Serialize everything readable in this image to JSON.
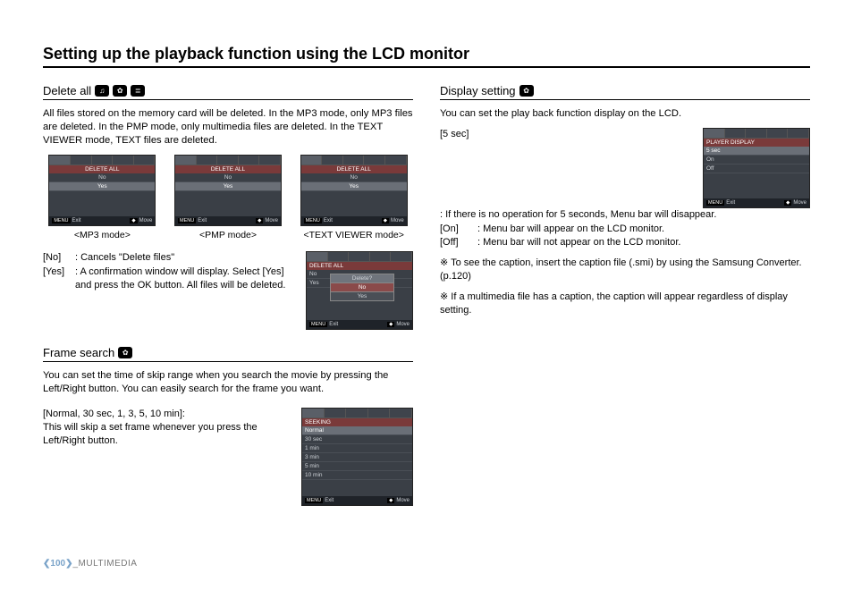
{
  "title": "Setting up the playback function using the LCD monitor",
  "footer": {
    "page": "100",
    "section": "_MULTIMEDIA"
  },
  "icons": {
    "music": "♫",
    "gear": "✿",
    "text": "≣"
  },
  "screen_ui": {
    "menu_label": "MENU",
    "exit": "Exit",
    "move": "Move",
    "arrows": "◆"
  },
  "left": {
    "delete_all": {
      "title": "Delete all",
      "body": "All files stored on the memory card will be deleted. In the MP3 mode, only MP3 files are deleted. In the PMP mode, only multimedia files are deleted. In the TEXT VIEWER mode, TEXT files are deleted.",
      "screens": {
        "header": "DELETE ALL",
        "items": [
          "No",
          "Yes"
        ],
        "captions": [
          "<MP3 mode>",
          "<PMP mode>",
          "<TEXT VIEWER mode>"
        ]
      },
      "options": [
        {
          "label": "[No]",
          "desc": ": Cancels \"Delete files\""
        },
        {
          "label": "[Yes]",
          "desc": ": A confirmation window will display. Select [Yes] and press the OK button. All files will be deleted."
        }
      ],
      "dialog": {
        "title": "Delete?",
        "opts": [
          "No",
          "Yes"
        ]
      }
    },
    "frame_search": {
      "title": "Frame search",
      "body": "You can set the time of skip range when you search the movie by pressing the Left/Right button. You can easily search for the frame you want.",
      "option_title": "[Normal, 30 sec, 1, 3, 5, 10 min]:",
      "option_body": "This will skip a set frame whenever you press the Left/Right button.",
      "screen": {
        "header": "SEEKING",
        "items": [
          "Normal",
          "30 sec",
          "1 min",
          "3 min",
          "5 min",
          "10 min"
        ]
      }
    }
  },
  "right": {
    "display_setting": {
      "title": "Display setting",
      "body": "You can set the play back function display on the LCD.",
      "options": [
        {
          "label": "[5 sec]",
          "desc": ": If there is no operation for 5 seconds, Menu bar will disappear."
        },
        {
          "label": "[On]",
          "desc": ": Menu bar will appear on the LCD monitor."
        },
        {
          "label": "[Off]",
          "desc": ": Menu bar will not appear on the LCD monitor."
        }
      ],
      "screen": {
        "header": "PLAYER DISPLAY",
        "items": [
          "5 sec",
          "On",
          "Off"
        ]
      },
      "notes": [
        "To see the caption, insert the caption file  (.smi) by using the Samsung Converter. (p.120)",
        "If a multimedia file has a caption, the caption will appear regardless of display setting."
      ],
      "note_sym": "※"
    }
  }
}
